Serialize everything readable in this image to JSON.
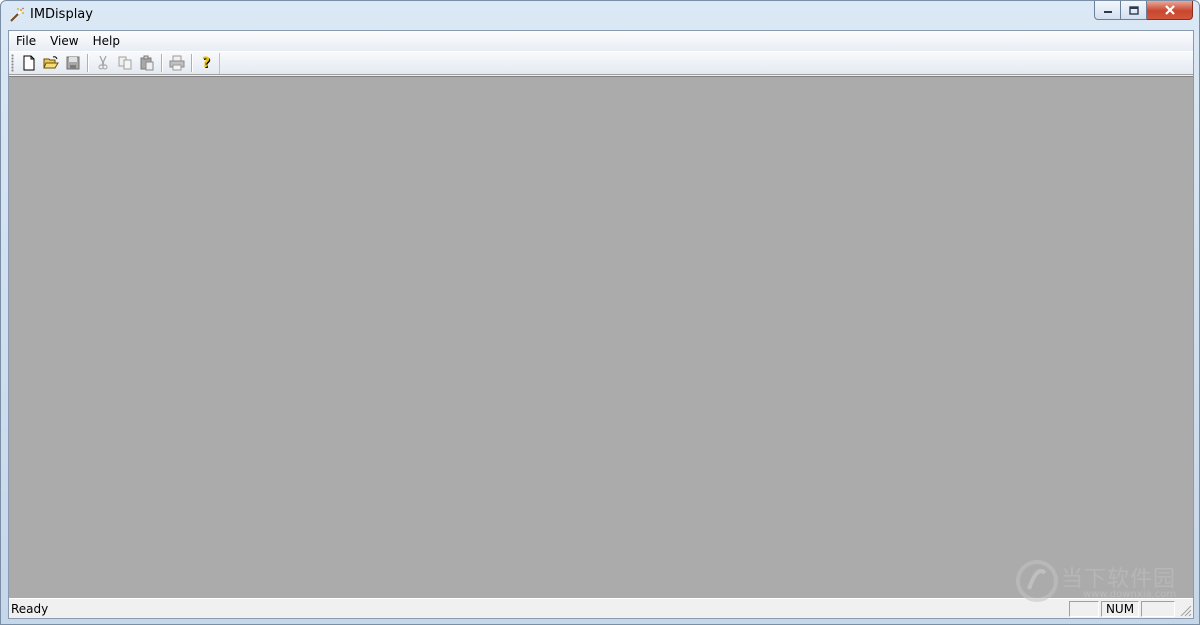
{
  "window": {
    "title": "IMDisplay",
    "app_icon": "magic-wand-icon",
    "buttons": {
      "minimize": "minimize-icon",
      "maximize": "maximize-icon",
      "close": "close-icon"
    }
  },
  "menubar": {
    "items": [
      {
        "label": "File"
      },
      {
        "label": "View"
      },
      {
        "label": "Help"
      }
    ]
  },
  "toolbar": {
    "buttons": [
      {
        "icon": "new-file-icon",
        "enabled": true
      },
      {
        "icon": "open-folder-icon",
        "enabled": true
      },
      {
        "icon": "save-icon",
        "enabled": false
      },
      {
        "icon": "cut-icon",
        "enabled": false
      },
      {
        "icon": "copy-icon",
        "enabled": false
      },
      {
        "icon": "paste-icon",
        "enabled": false
      },
      {
        "icon": "print-icon",
        "enabled": false
      },
      {
        "icon": "help-icon",
        "enabled": true
      }
    ]
  },
  "statusbar": {
    "message": "Ready",
    "panes": {
      "caps": "",
      "num": "NUM",
      "scrl": ""
    }
  },
  "watermark": {
    "text": "当下软件园",
    "url": "www.downxia.com"
  },
  "colors": {
    "canvas": "#ababab",
    "chrome": "#f0f0f0",
    "close_button": "#c8462f"
  }
}
